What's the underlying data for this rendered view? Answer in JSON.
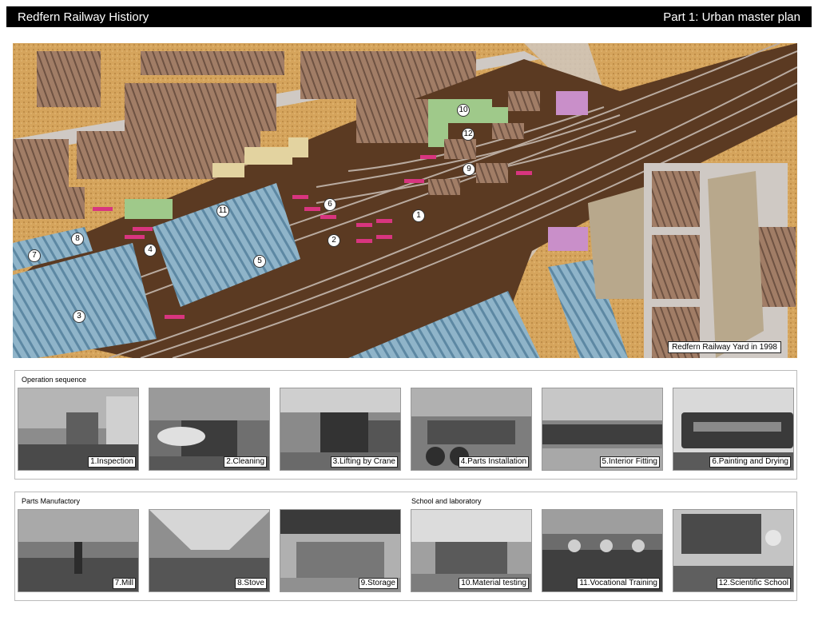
{
  "header": {
    "left_title": "Redfern Railway Histiory",
    "right_title": "Part 1: Urban master plan"
  },
  "map": {
    "caption": "Redfern Railway Yard in 1998",
    "markers": [
      "1",
      "2",
      "3",
      "4",
      "5",
      "6",
      "7",
      "8",
      "9",
      "10",
      "11",
      "12"
    ]
  },
  "operation": {
    "label": "Operation sequence",
    "photos": [
      "1.Inspection",
      "2.Cleaning",
      "3.Lifting by Crane",
      "4.Parts Installation",
      "5.Interior Fitting",
      "6.Painting and Drying"
    ]
  },
  "facilities": {
    "parts_label": "Parts Manufactory",
    "school_label": "School and laboratory",
    "photos": [
      "7.Mill",
      "8.Stove",
      "9.Storage",
      "10.Material testing",
      "11.Vocational Training",
      "12.Scientific School"
    ]
  },
  "colors": {
    "ground": "#d5a45c",
    "yard": "#5b3a22",
    "shed_blue": "#8fb4c9",
    "building": "#a17d66",
    "green": "#9fc98a",
    "pink": "#c98fc9",
    "wagon": "#d8357f"
  }
}
